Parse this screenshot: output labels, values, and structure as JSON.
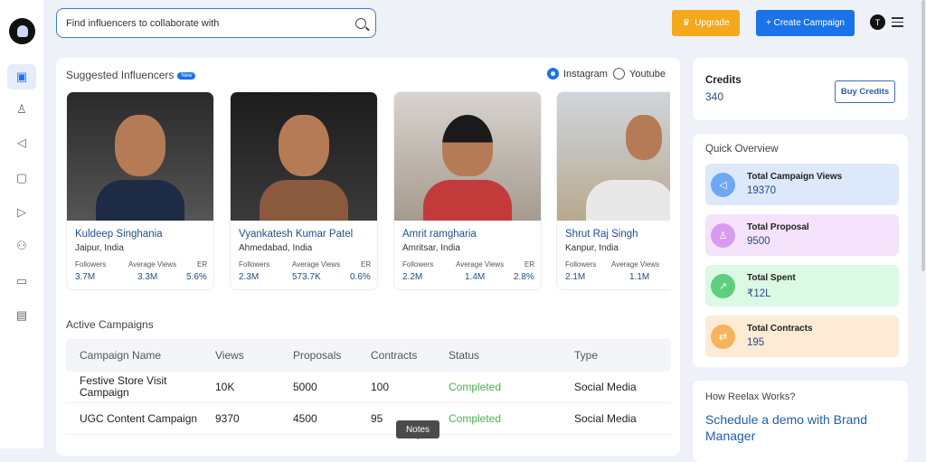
{
  "header": {
    "search_placeholder": "Find influencers to collaborate with",
    "upgrade_label": "Upgrade",
    "create_label": "+ Create Campaign",
    "avatar_initial": "T"
  },
  "sidebar": {
    "items": [
      "dashboard-icon",
      "profile-icon",
      "megaphone-icon",
      "contact-card-icon",
      "video-add-icon",
      "team-icon",
      "chat-icon",
      "wallet-icon"
    ]
  },
  "suggested": {
    "title": "Suggested Influencers",
    "badge": "New",
    "platforms": [
      {
        "label": "Instagram",
        "selected": true
      },
      {
        "label": "Youtube",
        "selected": false
      }
    ],
    "stat_labels": {
      "followers": "Followers",
      "avg_views": "Average Views",
      "er": "ER"
    },
    "influencers": [
      {
        "name": "Kuldeep Singhania",
        "location": "Jaipur, India",
        "followers": "3.7M",
        "avg_views": "3.3M",
        "er": "5.6%"
      },
      {
        "name": "Vyankatesh Kumar Patel",
        "location": "Ahmedabad, India",
        "followers": "2.3M",
        "avg_views": "573.7K",
        "er": "0.6%"
      },
      {
        "name": "Amrit ramgharia",
        "location": "Amritsar, India",
        "followers": "2.2M",
        "avg_views": "1.4M",
        "er": "2.8%"
      },
      {
        "name": "Shrut Raj Singh",
        "location": "Kanpur, India",
        "followers": "2.1M",
        "avg_views": "1.1M",
        "er": ""
      }
    ]
  },
  "campaigns": {
    "title": "Active Campaigns",
    "columns": [
      "Campaign Name",
      "Views",
      "Proposals",
      "Contracts",
      "Status",
      "Type"
    ],
    "rows": [
      {
        "name": "Festive Store Visit Campaign",
        "views": "10K",
        "proposals": "5000",
        "contracts": "100",
        "status": "Completed",
        "type": "Social Media"
      },
      {
        "name": "UGC Content Campaign",
        "views": "9370",
        "proposals": "4500",
        "contracts": "95",
        "status": "Completed",
        "type": "Social Media"
      }
    ]
  },
  "credits": {
    "label": "Credits",
    "value": "340",
    "buy_label": "Buy Credits"
  },
  "overview": {
    "title": "Quick Overview",
    "stats": [
      {
        "label": "Total Campaign Views",
        "value": "19370",
        "bg": "#dde9fb",
        "icon_bg": "#6ea8f5",
        "icon": "megaphone-icon"
      },
      {
        "label": "Total Proposal",
        "value": "9500",
        "bg": "#f4e3fb",
        "icon_bg": "#d99bf0",
        "icon": "user-icon"
      },
      {
        "label": "Total Spent",
        "value": "₹12L",
        "bg": "#dcf9e3",
        "icon_bg": "#5fcf7f",
        "icon": "export-icon"
      },
      {
        "label": "Total Contracts",
        "value": "195",
        "bg": "#fdebd5",
        "icon_bg": "#f7b35b",
        "icon": "swap-icon"
      }
    ]
  },
  "how": {
    "title": "How Reelax Works?",
    "link": "Schedule a demo with Brand Manager"
  },
  "tooltip": {
    "notes": "Notes"
  }
}
